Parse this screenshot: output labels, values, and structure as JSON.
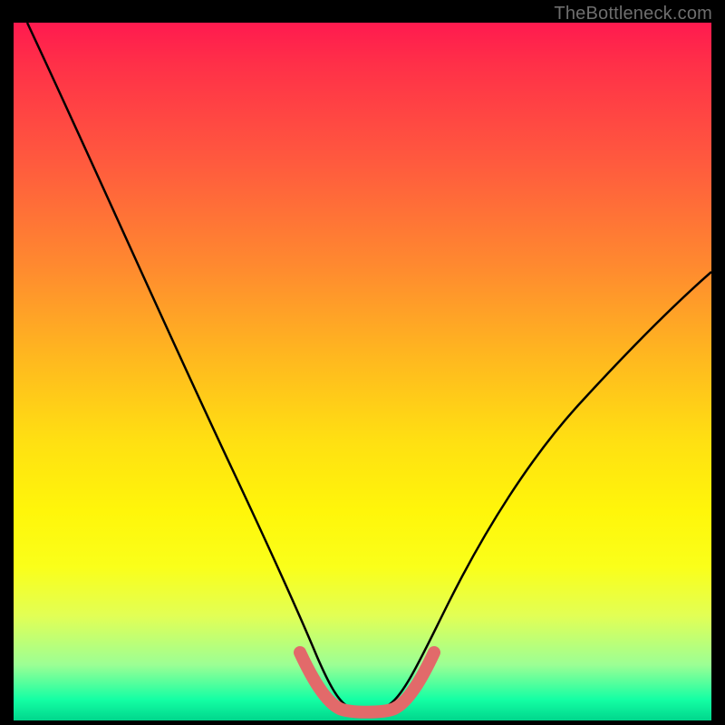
{
  "watermark": "TheBottleneck.com",
  "chart_data": {
    "type": "line",
    "title": "",
    "xlabel": "",
    "ylabel": "",
    "xlim": [
      0,
      100
    ],
    "ylim": [
      0,
      100
    ],
    "grid": false,
    "legend": false,
    "background_gradient": {
      "top": "#ff1a4f",
      "mid": "#ffe012",
      "bottom": "#00d68c"
    },
    "series": [
      {
        "name": "main-curve",
        "color": "#000000",
        "x": [
          0,
          5,
          10,
          15,
          20,
          25,
          30,
          35,
          40,
          45,
          48,
          50,
          52,
          55,
          60,
          65,
          70,
          75,
          80,
          85,
          90,
          95,
          100
        ],
        "y": [
          100,
          91,
          82,
          73,
          64,
          55,
          46,
          37,
          27,
          14,
          4,
          2,
          2,
          4,
          14,
          24,
          32,
          40,
          47,
          53,
          58,
          62,
          65
        ]
      },
      {
        "name": "bottom-highlight",
        "color": "#e26a6a",
        "x": [
          40,
          44,
          48,
          50,
          52,
          56,
          60
        ],
        "y": [
          10,
          4,
          2,
          2,
          2,
          4,
          10
        ]
      }
    ],
    "annotations": []
  }
}
